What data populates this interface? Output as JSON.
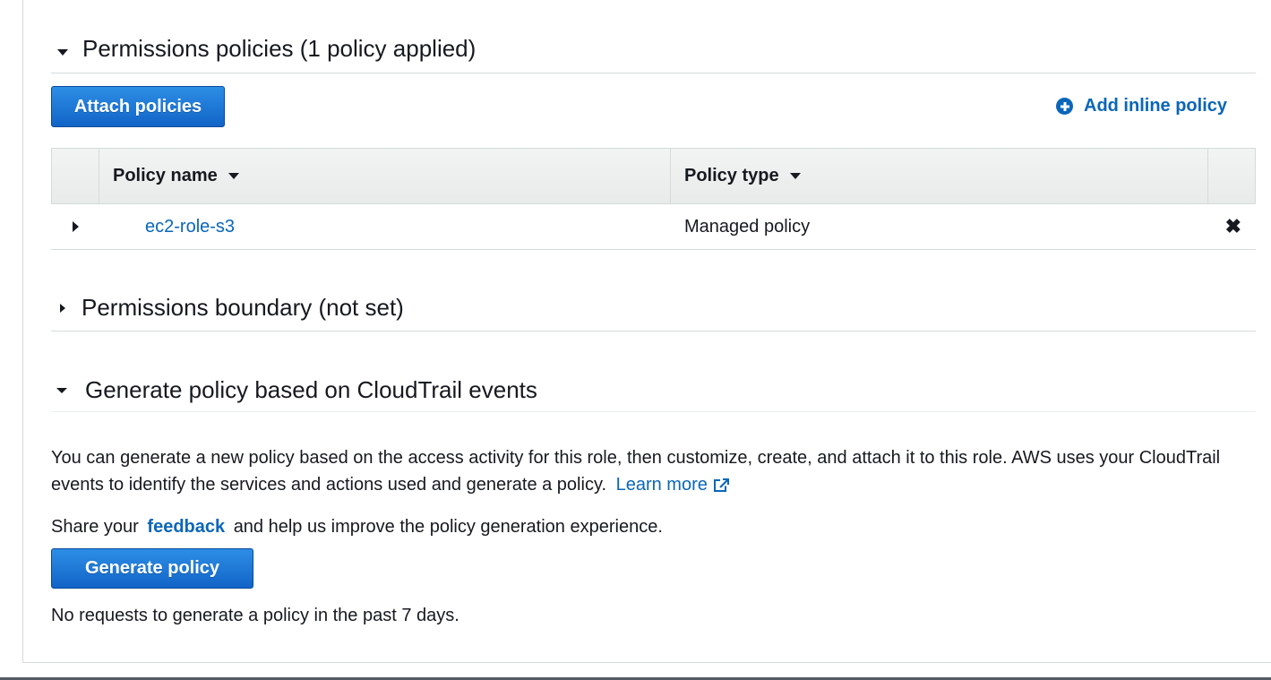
{
  "sections": {
    "permissions_policies": {
      "title": "Permissions policies (1 policy applied)"
    },
    "permissions_boundary": {
      "title": "Permissions boundary (not set)"
    },
    "generate_policy": {
      "title": "Generate policy based on CloudTrail events"
    }
  },
  "buttons": {
    "attach_policies": "Attach policies",
    "add_inline_policy": "Add inline policy",
    "generate_policy": "Generate policy"
  },
  "table": {
    "columns": [
      "Policy name",
      "Policy type"
    ],
    "rows": [
      {
        "policy_name": "ec2-role-s3",
        "policy_type": "Managed policy"
      }
    ]
  },
  "generate": {
    "description_part1": "You can generate a new policy based on the access activity for this role, then customize, create, and attach it to this role. AWS uses your CloudTrail events to identify the services and actions used and generate a policy.",
    "learn_more": "Learn more",
    "feedback_prefix": "Share your",
    "feedback_link": "feedback",
    "feedback_suffix": "and help us improve the policy generation experience.",
    "status": "No requests to generate a policy in the past 7 days."
  },
  "colors": {
    "link": "#0a66b8",
    "primary_button": "#1a73d6",
    "border": "#d5dbdb"
  }
}
